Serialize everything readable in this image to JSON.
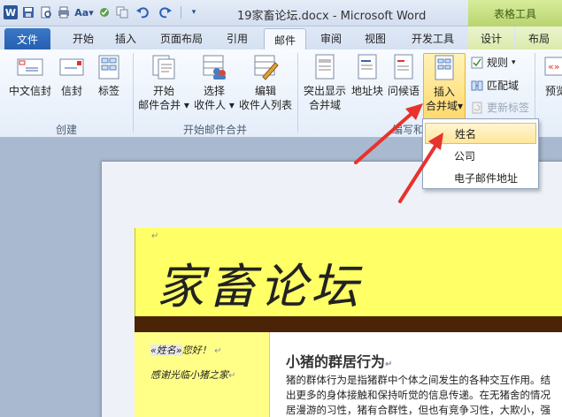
{
  "title_bar": {
    "document_title": "19家畜论坛.docx - Microsoft Word",
    "context_tab_group": "表格工具",
    "qat_icons": [
      "word-logo",
      "save-icon",
      "print-preview-icon",
      "print-icon",
      "font-size-icon",
      "spell-check-icon",
      "copy-icon",
      "undo-icon",
      "redo-icon",
      "customize-icon"
    ]
  },
  "tabs": [
    {
      "label": "文件"
    },
    {
      "label": "开始"
    },
    {
      "label": "插入"
    },
    {
      "label": "页面布局"
    },
    {
      "label": "引用"
    },
    {
      "label": "邮件"
    },
    {
      "label": "审阅"
    },
    {
      "label": "视图"
    },
    {
      "label": "开发工具"
    },
    {
      "label": "设计"
    },
    {
      "label": "布局"
    }
  ],
  "ribbon": {
    "create": {
      "label": "创建",
      "chinese_envelope": "中文信封",
      "envelope": "信封",
      "labels": "标签"
    },
    "start_merge": {
      "label": "开始邮件合并",
      "start_line1": "开始",
      "start_line2": "邮件合并",
      "select_line1": "选择",
      "select_line2": "收件人",
      "edit_line1": "编辑",
      "edit_line2": "收件人列表"
    },
    "write_insert": {
      "label_partial": "编写和插",
      "highlight_line1": "突出显示",
      "highlight_line2": "合并域",
      "address_block": "地址块",
      "greeting_line": "问候语",
      "insert_line1": "插入",
      "insert_line2": "合并域",
      "rules": "规则",
      "match_fields": "匹配域",
      "update_labels": "更新标签"
    },
    "preview_partial": "预览"
  },
  "dropdown": {
    "items": [
      "姓名",
      "公司",
      "电子邮件地址"
    ],
    "selected": "姓名"
  },
  "document": {
    "title": "家畜论坛",
    "greeting_field": "«姓名»",
    "greeting_text": "您好！",
    "thanks": "感谢光临小猪之家",
    "article_title": "小猪的群居行为",
    "body_lines": [
      "猪的群体行为是指猪群中个体之间发生的各种交互作用。结",
      "出更多的身体接触和保持听觉的信息传递。在无猪舍的情况",
      "居漫游的习性，猪有合群性，但也有竞争习性，大欺小，强"
    ],
    "paragraph_mark": "↵"
  },
  "colors": {
    "title_band": "#ffff66",
    "brown_bar": "#4b2307",
    "sidebar": "#ffff88",
    "arrow": "#e8322c"
  }
}
